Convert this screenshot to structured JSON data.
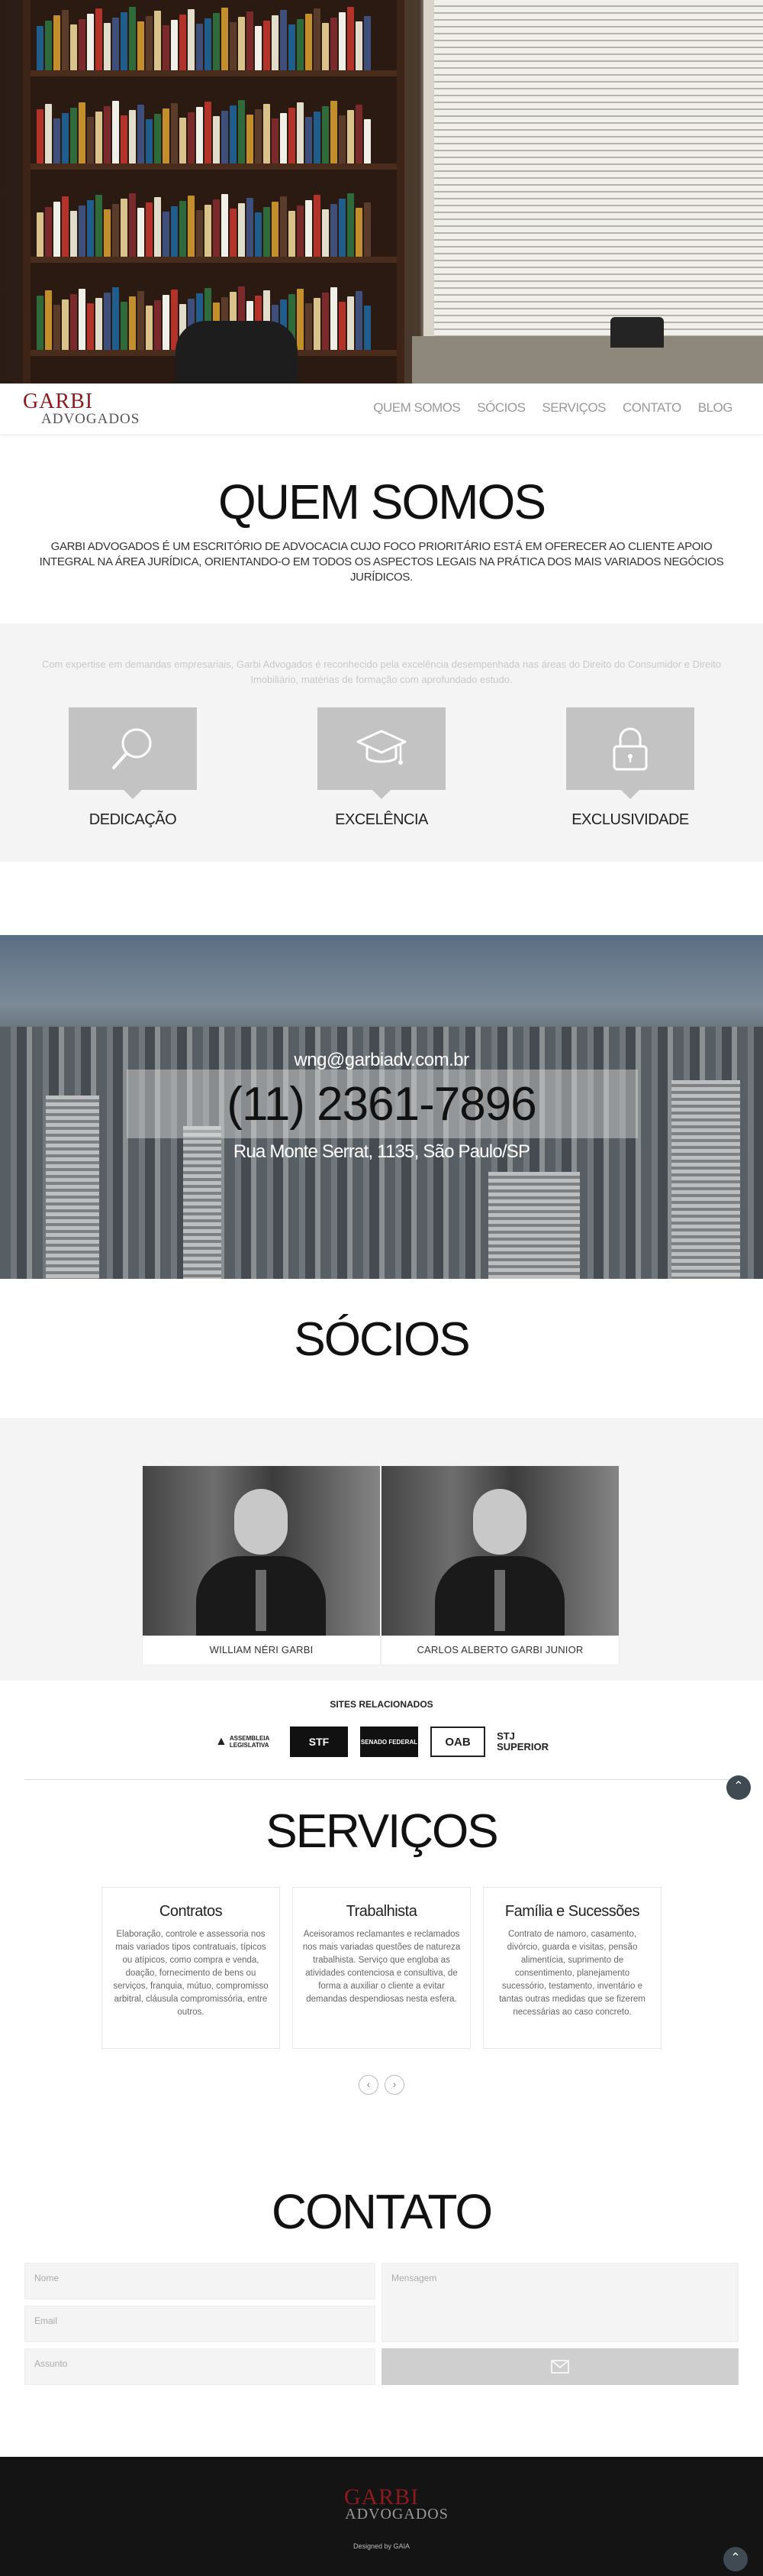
{
  "brand": {
    "name_line1": "GARBI",
    "name_line2": "ADVOGADOS"
  },
  "nav": {
    "items": [
      "QUEM SOMOS",
      "SÓCIOS",
      "SERVIÇOS",
      "CONTATO",
      "BLOG"
    ]
  },
  "about": {
    "title": "QUEM SOMOS",
    "text": "GARBI ADVOGADOS É UM ESCRITÓRIO DE ADVOCACIA CUJO FOCO PRIORITÁRIO ESTÁ EM OFERECER AO CLIENTE APOIO INTEGRAL NA ÁREA JURÍDICA, ORIENTANDO-O EM TODOS OS ASPECTOS LEGAIS NA PRÁTICA DOS MAIS VARIADOS NEGÓCIOS JURÍDICOS.",
    "features_text": "Com expertise em demandas empresariais, Garbi Advogados é reconhecido pela excelência desempenhada nas áreas do Direito do Consumidor e Direito Imobiliário, matérias de formação com aprofundado estudo.",
    "features": [
      {
        "label": "DEDICAÇÃO",
        "icon": "magnifier-icon"
      },
      {
        "label": "EXCELÊNCIA",
        "icon": "graduation-cap-icon"
      },
      {
        "label": "EXCLUSIVIDADE",
        "icon": "padlock-icon"
      }
    ]
  },
  "contact_banner": {
    "email": "wng@garbiadv.com.br",
    "phone": "(11) 2361-7896",
    "address": "Rua Monte Serrat, 1135, São Paulo/SP"
  },
  "partners": {
    "title": "SÓCIOS",
    "items": [
      {
        "name": "WILLIAM NÉRI GARBI"
      },
      {
        "name": "CARLOS ALBERTO GARBI JUNIOR"
      }
    ]
  },
  "related_sites": {
    "title": "SITES RELACIONADOS",
    "logos": [
      {
        "name": "assembleia-legislativa-logo",
        "text": "ASSEMBLEIA LEGISLATIVA"
      },
      {
        "name": "stf-logo",
        "text": "STF"
      },
      {
        "name": "senado-federal-logo",
        "text": "SENADO FEDERAL"
      },
      {
        "name": "oab-logo",
        "text": "OAB"
      },
      {
        "name": "stj-logo",
        "text": "STJ SUPERIOR"
      }
    ]
  },
  "services": {
    "title": "SERVIÇOS",
    "items": [
      {
        "title": "Contratos",
        "text": "Elaboração, controle e assessoria nos mais variados tipos contratuais, típicos ou atípicos, como compra e venda, doação, fornecimento de bens ou serviços, franquia, mútuo, compromisso arbitral, cláusula compromissória, entre outros."
      },
      {
        "title": "Trabalhista",
        "text": "Aceisoramos reclamantes e reclamados nos mais variadas questões de natureza trabalhista. Serviço que engloba as atividades contenciosa e consultiva, de forma a auxiliar o cliente a evitar demandas despendiosas nesta esfera."
      },
      {
        "title": "Família e Sucessões",
        "text": "Contrato de namoro, casamento, divórcio, guarda e visitas, pensão alimentícia, suprimento de consentimento, planejamento sucessório, testamento, inventário e tantas outras medidas que se fizerem necessárias ao caso concreto."
      }
    ],
    "prev": "‹",
    "next": "›"
  },
  "contact_form": {
    "title": "CONTATO",
    "name_placeholder": "Nome",
    "email_placeholder": "Email",
    "subject_placeholder": "Assunto",
    "message_placeholder": "Mensagem",
    "send_icon": "envelope-icon"
  },
  "footer": {
    "credit": "Designed by GAIA"
  },
  "scroll_top": "⌃"
}
